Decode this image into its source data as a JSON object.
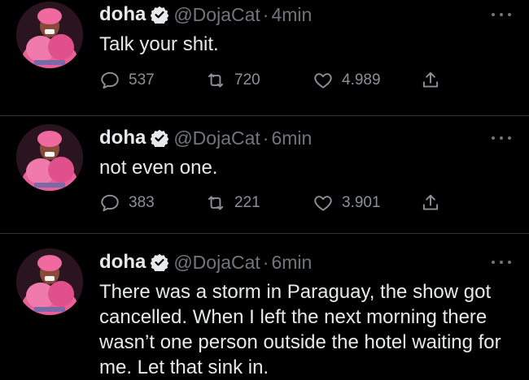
{
  "theme": {
    "background": "#000000",
    "text": "#e7e9ea",
    "muted": "#71767b",
    "divider": "#2f3336",
    "verified_badge": "#e7e9ea"
  },
  "tweets": [
    {
      "name": "doha",
      "handle": "@DojaCat",
      "separator": "·",
      "time": "4min",
      "text": "Talk your shit.",
      "actions": {
        "reply_count": "537",
        "retweet_count": "720",
        "like_count": "4.989",
        "reply_icon": "reply-icon",
        "retweet_icon": "retweet-icon",
        "like_icon": "heart-icon",
        "share_icon": "share-icon"
      }
    },
    {
      "name": "doha",
      "handle": "@DojaCat",
      "separator": "·",
      "time": "6min",
      "text": "not even one.",
      "actions": {
        "reply_count": "383",
        "retweet_count": "221",
        "like_count": "3.901",
        "reply_icon": "reply-icon",
        "retweet_icon": "retweet-icon",
        "like_icon": "heart-icon",
        "share_icon": "share-icon"
      }
    },
    {
      "name": "doha",
      "handle": "@DojaCat",
      "separator": "·",
      "time": "6min",
      "text": "There was a storm in Paraguay, the show got cancelled. When I left the next morning there wasn’t one person outside the hotel waiting for me. Let that sink in."
    }
  ]
}
